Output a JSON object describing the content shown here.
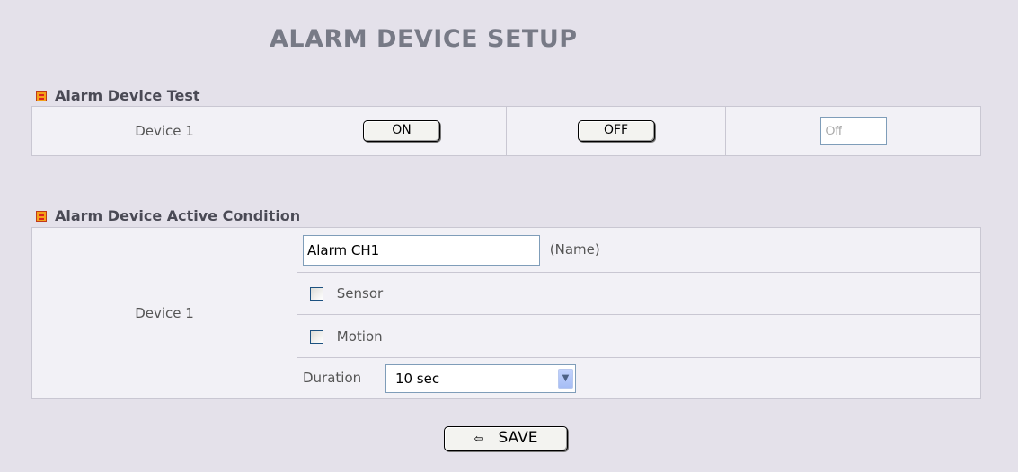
{
  "page": {
    "title": "ALARM DEVICE SETUP"
  },
  "test_section": {
    "header": "Alarm Device Test",
    "device_label": "Device 1",
    "on_label": "ON",
    "off_label": "OFF",
    "status_value": "Off"
  },
  "active_section": {
    "header": "Alarm Device Active Condition",
    "device_label": "Device 1",
    "name_value": "Alarm CH1",
    "name_hint": "(Name)",
    "sensor_label": "Sensor",
    "sensor_checked": false,
    "motion_label": "Motion",
    "motion_checked": false,
    "duration_label": "Duration",
    "duration_value": "10 sec"
  },
  "save": {
    "arrow": "⇦",
    "label": "SAVE"
  },
  "icons": {
    "section_icon": "list-icon",
    "select_arrow": "chevron-down-icon",
    "save_arrow": "left-arrow-icon"
  },
  "colors": {
    "background": "#e4e1ea",
    "table": "#f2f1f6",
    "title": "#777a86",
    "section_icon": "#f4a21a"
  }
}
